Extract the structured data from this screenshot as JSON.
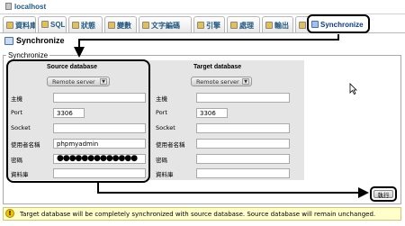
{
  "server": {
    "label": "localhost"
  },
  "tabs": [
    {
      "label": "資料庫",
      "icon": "database-icon"
    },
    {
      "label": "SQL",
      "icon": "sql-icon"
    },
    {
      "label": "狀態",
      "icon": "status-icon"
    },
    {
      "label": "變數",
      "icon": "variables-icon"
    },
    {
      "label": "文字編碼",
      "icon": "charset-icon"
    },
    {
      "label": "引擎",
      "icon": "engines-icon"
    },
    {
      "label": "處理",
      "icon": "processes-icon"
    },
    {
      "label": "輸出",
      "icon": "export-icon"
    },
    {
      "label": "載入",
      "icon": "import-icon"
    },
    {
      "label": "Synchronize",
      "icon": "synchronize-icon",
      "active": true
    }
  ],
  "page": {
    "title": "Synchronize"
  },
  "fieldset": {
    "legend": "Synchronize"
  },
  "source": {
    "heading": "Source database",
    "server_select": "Remote server",
    "labels": {
      "host": "主機",
      "port": "Port",
      "socket": "Socket",
      "user": "使用者名稱",
      "password": "密碼",
      "database": "資料庫"
    },
    "values": {
      "host": "",
      "port": "3306",
      "socket": "",
      "user": "phpmyadmin",
      "password": "●●●●●●●●●●●●●",
      "database": ""
    }
  },
  "target": {
    "heading": "Target database",
    "server_select": "Remote server",
    "labels": {
      "host": "主機",
      "port": "Port",
      "socket": "Socket",
      "user": "使用者名稱",
      "password": "密碼",
      "database": "資料庫"
    },
    "values": {
      "host": "",
      "port": "3306",
      "socket": "",
      "user": "",
      "password": "",
      "database": ""
    }
  },
  "actions": {
    "execute_label": "執行"
  },
  "notice": {
    "text": "Target database will be completely synchronized with source database. Source database will remain unchanged."
  },
  "colors": {
    "tab_text": "#235a81",
    "notice_bg": "#ffffcc",
    "form_bg": "#e5e5e5",
    "annotation": "#000000"
  }
}
